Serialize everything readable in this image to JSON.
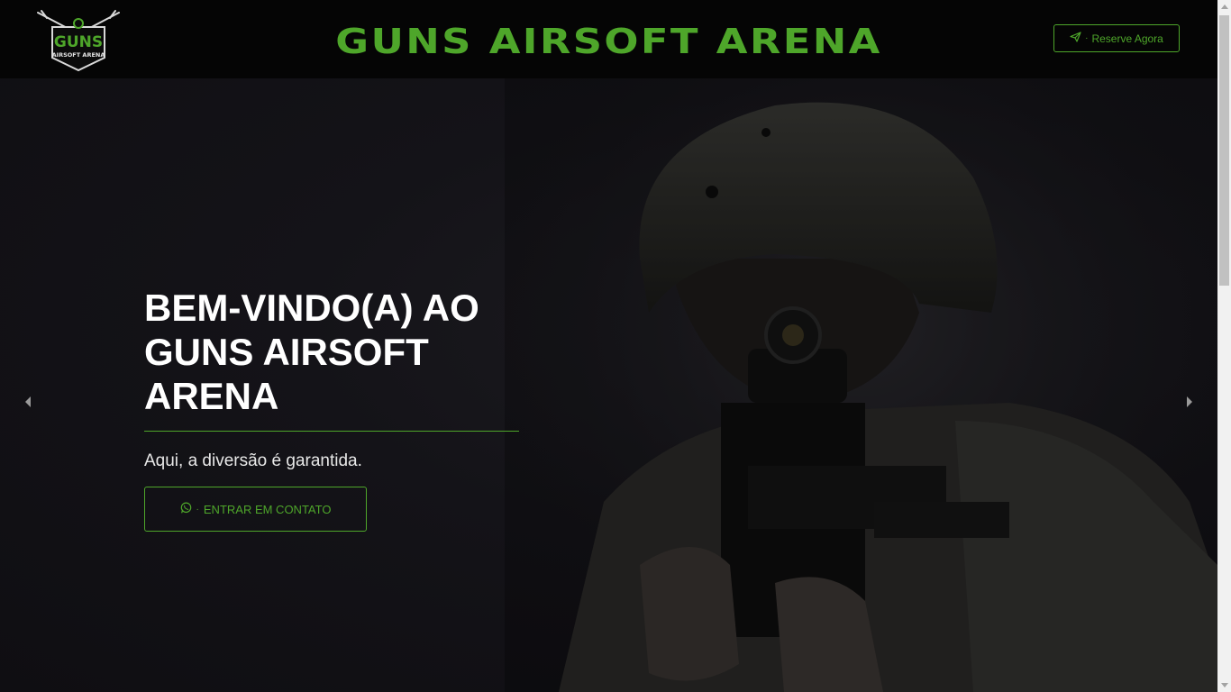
{
  "header": {
    "logo_text_main": "GUNS",
    "logo_text_sub": "AIRSOFT ARENA",
    "title": "GUNS AIRSOFT ARENA",
    "reserve_button": {
      "label": "Reserve Agora",
      "separator": "·",
      "icon": "paper-plane-icon"
    }
  },
  "hero": {
    "title": "BEM-VINDO(A) AO GUNS AIRSOFT ARENA",
    "subtitle": "Aqui, a diversão é garantida.",
    "contact_button": {
      "label": "ENTRAR EM CONTATO",
      "separator": "·",
      "icon": "whatsapp-icon"
    }
  },
  "carousel": {
    "prev_icon": "chevron-left-icon",
    "next_icon": "chevron-right-icon"
  },
  "colors": {
    "accent": "#4ea62a",
    "header_bg": "#050505",
    "hero_bg": "#141318",
    "text": "#ffffff"
  }
}
